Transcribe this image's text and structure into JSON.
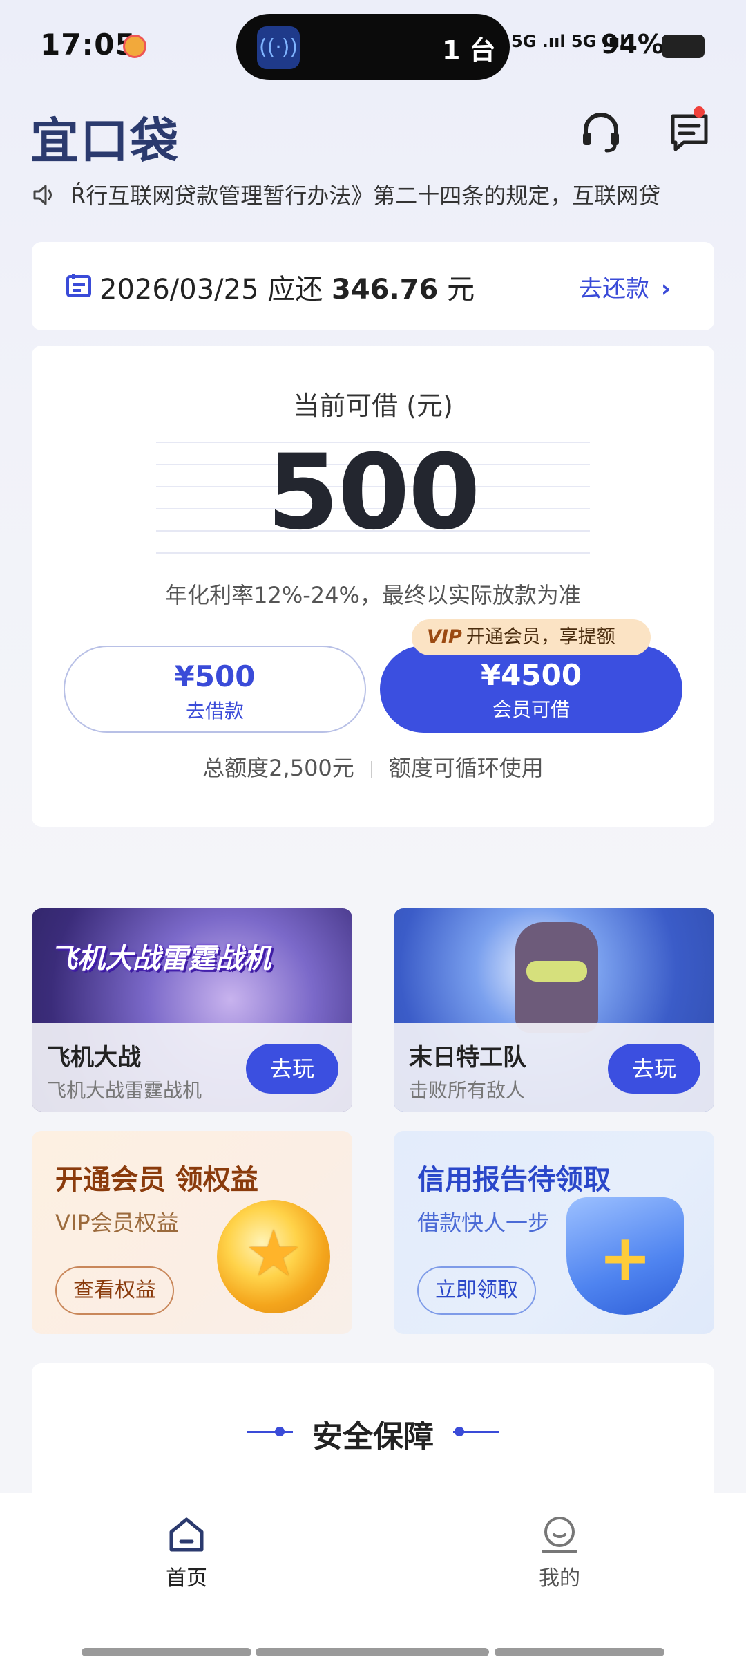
{
  "status_bar": {
    "time": "17:05",
    "island_count": "1 台",
    "signal": "5G .ııl 5G .ııl",
    "battery_pct": "94%"
  },
  "header": {
    "logo_text": "宜口袋",
    "icons": [
      "headset-icon",
      "message-icon"
    ]
  },
  "notice": {
    "text": "Ŕ行互联网贷款管理暂行办法》第二十四条的规定，互联网贷"
  },
  "repay": {
    "date": "2026/03/25",
    "due_label": "应还",
    "amount": "346.76",
    "unit": "元",
    "action": "去还款"
  },
  "borrow": {
    "title": "当前可借 (元)",
    "amount": "500",
    "rate_note": "年化利率12%-24%，最终以实际放款为准",
    "btn_borrow_amount": "¥500",
    "btn_borrow_label": "去借款",
    "btn_vip_amount": "¥4500",
    "btn_vip_label": "会员可借",
    "vip_tag_prefix": "VIP",
    "vip_tag_text": "开通会员，享提额",
    "total_limit": "总额度2,500元",
    "limit_note": "额度可循环使用"
  },
  "games": [
    {
      "banner": "飞机大战雷霆战机",
      "name": "飞机大战",
      "desc": "飞机大战雷霆战机",
      "action": "去玩"
    },
    {
      "banner": "",
      "name": "末日特工队",
      "desc": "击败所有敌人",
      "action": "去玩"
    }
  ],
  "promos": [
    {
      "title": "开通会员 领权益",
      "sub": "VIP会员权益",
      "action": "查看权益"
    },
    {
      "title": "信用报告待领取",
      "sub": "借款快人一步",
      "action": "立即领取"
    }
  ],
  "security": {
    "title": "安全保障"
  },
  "nav": [
    {
      "label": "首页",
      "icon": "home-icon"
    },
    {
      "label": "我的",
      "icon": "profile-icon"
    }
  ],
  "colors": {
    "primary": "#3b4fe0",
    "logo": "#2b3a6e",
    "vip_tag_bg": "#fbe3c4"
  }
}
